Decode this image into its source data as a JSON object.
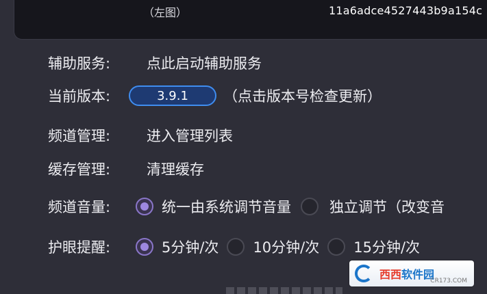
{
  "top_card": {
    "left_label": "（左图）",
    "device_id": "11a6adce4527443b9a154c"
  },
  "settings": {
    "accessibility": {
      "label": "辅助服务:",
      "value": "点此启动辅助服务"
    },
    "version": {
      "label": "当前版本:",
      "button": "3.9.1",
      "hint": "（点击版本号检查更新）"
    },
    "channel_manage": {
      "label": "频道管理:",
      "value": "进入管理列表"
    },
    "cache_manage": {
      "label": "缓存管理:",
      "value": "清理缓存"
    },
    "channel_volume": {
      "label": "频道音量:",
      "options": [
        "统一由系统调节音量",
        "独立调节（改变音"
      ],
      "selected": 0
    },
    "eye_reminder": {
      "label": "护眼提醒:",
      "options": [
        "5分钟/次",
        "10分钟/次",
        "15分钟/次"
      ],
      "selected": 0
    }
  },
  "watermark": {
    "brand_a": "西西",
    "brand_b": "软件园",
    "site": "CR173.COM"
  },
  "colors": {
    "background": "#2e2e38",
    "accent": "#9d87e0",
    "button_border": "#3f8df0"
  }
}
